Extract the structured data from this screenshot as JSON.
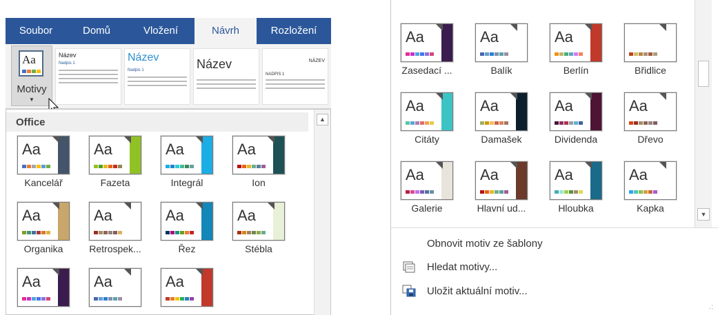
{
  "left": {
    "ribbon_tabs": [
      {
        "label": "Soubor",
        "active": false
      },
      {
        "label": "Domů",
        "active": false
      },
      {
        "label": "Vložení",
        "active": false
      },
      {
        "label": "Návrh",
        "active": true
      },
      {
        "label": "Rozložení",
        "active": false
      }
    ],
    "motivy_button": {
      "label": "Motivy",
      "icon": "themes-icon",
      "icon_text": "Aa"
    },
    "style_previews": [
      {
        "title": "Název",
        "subtitle": "Nadpis 1"
      },
      {
        "title": "Název",
        "subtitle": "Nadpis 1"
      },
      {
        "title": "Název",
        "subtitle": ""
      },
      {
        "title": "NÁZEV",
        "subtitle": "NADPIS 1"
      }
    ],
    "gallery_header": "Office",
    "themes": [
      {
        "name": "Kancelář",
        "aa": "Aa",
        "bar": "#44546a",
        "sw": [
          "#4472c4",
          "#ed7d31",
          "#a5a5a5",
          "#ffc000",
          "#5b9bd5",
          "#70ad47"
        ]
      },
      {
        "name": "Fazeta",
        "aa": "Aa",
        "bar": "#90c226",
        "sw": [
          "#90c226",
          "#54a021",
          "#e6b91e",
          "#e76618",
          "#c42f1a",
          "#918655"
        ]
      },
      {
        "name": "Integrál",
        "aa": "Aa",
        "bar": "#1cade4",
        "sw": [
          "#1cade4",
          "#2683c6",
          "#27ced7",
          "#42ba97",
          "#3e8853",
          "#62a39f"
        ]
      },
      {
        "name": "Ion",
        "aa": "Aa",
        "bar": "#1e5155",
        "sw": [
          "#b01513",
          "#ea6312",
          "#e6b729",
          "#6aac90",
          "#54849a",
          "#9e5e9b"
        ]
      },
      {
        "name": "Organika",
        "aa": "Aa",
        "bar": "#c9a66b",
        "sw": [
          "#83992a",
          "#3c9770",
          "#44709d",
          "#a23c33",
          "#d97828",
          "#deb340"
        ]
      },
      {
        "name": "Retrospek...",
        "aa": "Aa",
        "bar": "#ffffff",
        "sw": [
          "#9b2d1f",
          "#a28e6a",
          "#956251",
          "#918485",
          "#855d5d",
          "#d8b25c"
        ]
      },
      {
        "name": "Řez",
        "aa": "Aa",
        "bar": "#1287b8",
        "sw": [
          "#052f61",
          "#a50e82",
          "#14967c",
          "#6a9e1f",
          "#e87d37",
          "#c62324"
        ]
      },
      {
        "name": "Stébla",
        "aa": "Aa",
        "bar": "#e8f0d8",
        "sw": [
          "#a53010",
          "#de7e18",
          "#9f8351",
          "#728653",
          "#92aa4c",
          "#6aac91"
        ]
      },
      {
        "name": "",
        "aa": "Aa",
        "bar": "#3a1c4e",
        "sw": [
          "#e32d91",
          "#c830cc",
          "#4ea6dc",
          "#4775e7",
          "#8971e1",
          "#d54773"
        ]
      },
      {
        "name": "",
        "aa": "Aa",
        "bar": "#ffffff",
        "sw": [
          "#4a66ac",
          "#629dd1",
          "#297fd5",
          "#7f8fa9",
          "#5aa2ae",
          "#9d90a0"
        ]
      },
      {
        "name": "",
        "aa": "Aa",
        "bar": "#c0392b",
        "sw": [
          "#c0392b",
          "#e67e22",
          "#f1c40f",
          "#27ae60",
          "#2980b9",
          "#8e44ad"
        ]
      }
    ]
  },
  "right": {
    "themes": [
      {
        "name": "Zasedací ...",
        "aa": "Aa",
        "bar": "#3a1c4e",
        "sw": [
          "#e32d91",
          "#c830cc",
          "#4ea6dc",
          "#4775e7",
          "#8971e1",
          "#d54773"
        ]
      },
      {
        "name": "Balík",
        "aa": "Aa",
        "bar": "#ffffff",
        "sw": [
          "#4a66ac",
          "#629dd1",
          "#297fd5",
          "#7f8fa9",
          "#5aa2ae",
          "#9d90a0"
        ]
      },
      {
        "name": "Berlín",
        "aa": "Aa",
        "bar": "#c0392b",
        "sw": [
          "#f09415",
          "#c1b56b",
          "#4baf73",
          "#5aa6c0",
          "#d17df9",
          "#fa7e5c"
        ]
      },
      {
        "name": "Břidlice",
        "aa": "",
        "bar": "#ffffff",
        "sw": [
          "#bc451b",
          "#d3ba68",
          "#bb8640",
          "#ad9277",
          "#a55a43",
          "#ad9d7b"
        ]
      },
      {
        "name": "Citáty",
        "aa": "Aa",
        "bar": "#3cc4c4",
        "sw": [
          "#56c7aa",
          "#59a6d7",
          "#ab7eb1",
          "#e06d6d",
          "#f0a34f",
          "#e7cb4a"
        ]
      },
      {
        "name": "Damašek",
        "aa": "Aa",
        "bar": "#0b1e2c",
        "sw": [
          "#9eb060",
          "#d09a08",
          "#f2be5d",
          "#c86348",
          "#d9835c",
          "#a6765f"
        ]
      },
      {
        "name": "Dividenda",
        "aa": "Aa",
        "bar": "#4d1434",
        "sw": [
          "#4d1434",
          "#903163",
          "#b2324b",
          "#969fa7",
          "#66b1ce",
          "#40619d"
        ]
      },
      {
        "name": "Dřevo",
        "aa": "Aa",
        "bar": "#ffffff",
        "sw": [
          "#d34817",
          "#9b2d1f",
          "#a28e6a",
          "#956251",
          "#918485",
          "#855d5d"
        ]
      },
      {
        "name": "Galerie",
        "aa": "Aa",
        "bar": "#e8e4dc",
        "sw": [
          "#b71e42",
          "#de478e",
          "#bc72f0",
          "#795faf",
          "#586ea6",
          "#6892a0"
        ]
      },
      {
        "name": "Hlavní ud...",
        "aa": "Aa",
        "bar": "#6b3a2a",
        "sw": [
          "#b01513",
          "#ea6312",
          "#e6b729",
          "#6aac90",
          "#5f9c9d",
          "#9e5e9b"
        ]
      },
      {
        "name": "Hloubka",
        "aa": "Aa",
        "bar": "#1a6a8a",
        "sw": [
          "#41aebd",
          "#97e9d5",
          "#a2cf49",
          "#608f3d",
          "#a28e6a",
          "#dbdb52"
        ]
      },
      {
        "name": "Kapka",
        "aa": "Aa",
        "bar": "#ffffff",
        "sw": [
          "#2fa3ee",
          "#4bcaad",
          "#86c157",
          "#d99c3f",
          "#ce6633",
          "#a35dd1"
        ]
      }
    ],
    "menu": [
      {
        "label": "Obnovit motiv ze šablony",
        "icon": ""
      },
      {
        "label": "Hledat motivy...",
        "icon": "browse-themes-icon"
      },
      {
        "label": "Uložit aktuální motiv...",
        "icon": "save-theme-icon"
      }
    ],
    "resize_grip": ".:"
  }
}
